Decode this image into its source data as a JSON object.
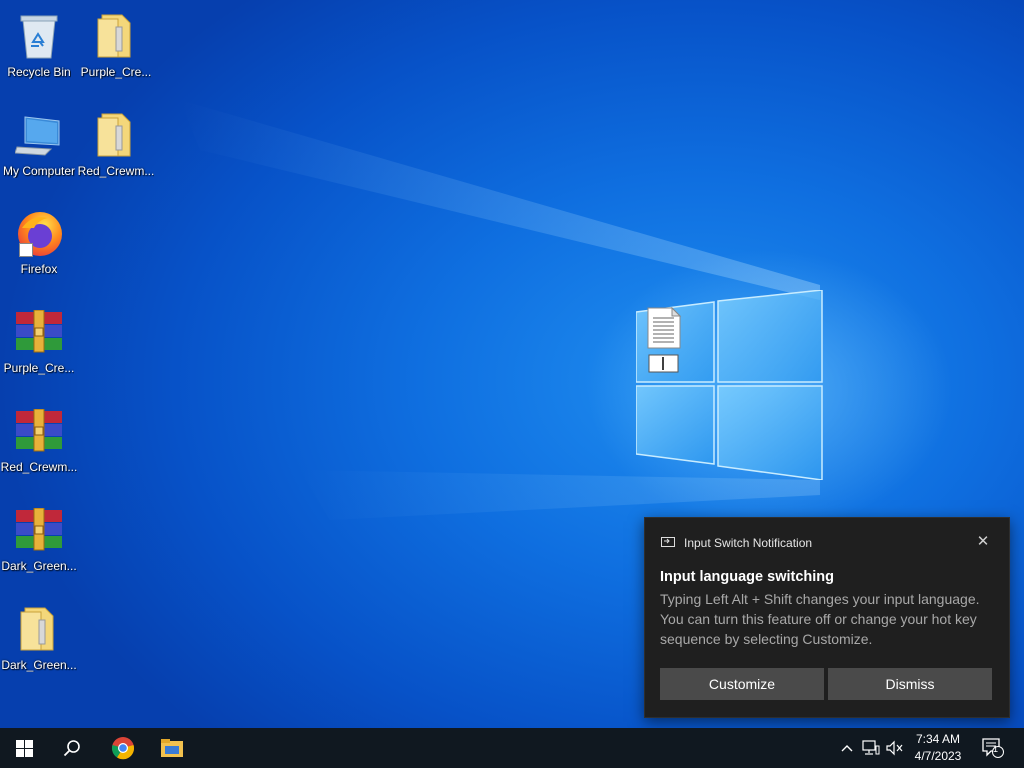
{
  "desktop": {
    "icons": [
      {
        "name": "recycle-bin",
        "label": "Recycle Bin"
      },
      {
        "name": "purple-crew-folder",
        "label": "Purple_Cre..."
      },
      {
        "name": "my-computer",
        "label": "My Computer"
      },
      {
        "name": "red-crew-folder",
        "label": "Red_Crewm..."
      },
      {
        "name": "firefox",
        "label": "Firefox"
      },
      {
        "name": "purple-crew-archive",
        "label": "Purple_Cre..."
      },
      {
        "name": "red-crew-archive",
        "label": "Red_Crewm..."
      },
      {
        "name": "dark-green-archive",
        "label": "Dark_Green..."
      },
      {
        "name": "dark-green-folder",
        "label": "Dark_Green..."
      }
    ]
  },
  "notification": {
    "app_name": "Input Switch Notification",
    "close_glyph": "✕",
    "title": "Input language switching",
    "body": "Typing Left Alt + Shift changes your input language. You can turn this feature off or change your hot key sequence by selecting Customize.",
    "customize_label": "Customize",
    "dismiss_label": "Dismiss"
  },
  "taskbar": {
    "time": "7:34 AM",
    "date": "4/7/2023",
    "notification_count": "1",
    "tray_chevron": "^"
  },
  "colors": {
    "taskbar_bg": "#101820",
    "toast_bg": "#1f1f1f",
    "toast_button": "#4a4a4a",
    "desktop_accent": "#0f6fe0"
  }
}
